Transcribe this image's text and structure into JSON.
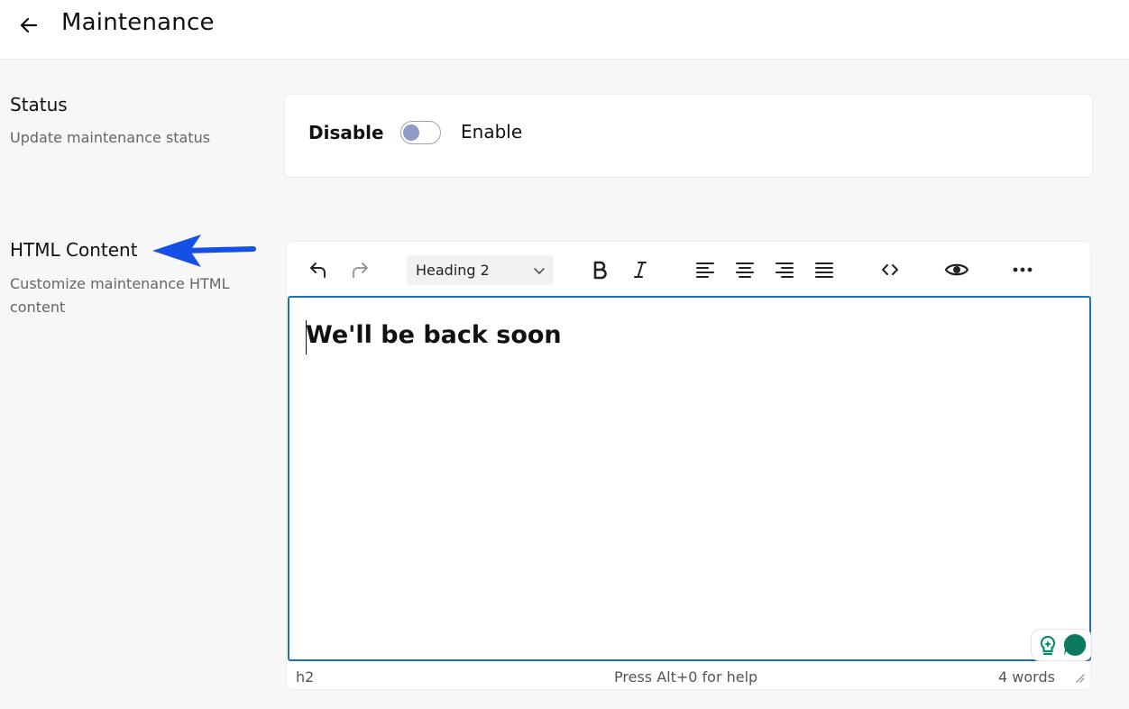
{
  "header": {
    "title": "Maintenance",
    "back_icon": "arrow-left-icon"
  },
  "status_section": {
    "title": "Status",
    "description": "Update maintenance status",
    "toggle": {
      "off_label": "Disable",
      "on_label": "Enable",
      "state": "off"
    }
  },
  "html_section": {
    "title": "HTML Content",
    "description": "Customize maintenance HTML content"
  },
  "editor": {
    "toolbar": {
      "block_format": "Heading 2",
      "buttons": [
        "undo-icon",
        "redo-icon",
        "bold-icon",
        "italic-icon",
        "align-left-icon",
        "align-center-icon",
        "align-right-icon",
        "justify-icon",
        "source-code-icon",
        "preview-icon",
        "more-icon"
      ]
    },
    "content_heading": "We'll be back soon",
    "statusbar": {
      "path": "h2",
      "help": "Press Alt+0 for help",
      "word_count": "4 words"
    }
  },
  "colors": {
    "accent_blue": "#1d71b8",
    "annotation_arrow": "#1450e6",
    "toggle_knob": "#8e9bc4",
    "assist_green": "#0b8a6e"
  }
}
